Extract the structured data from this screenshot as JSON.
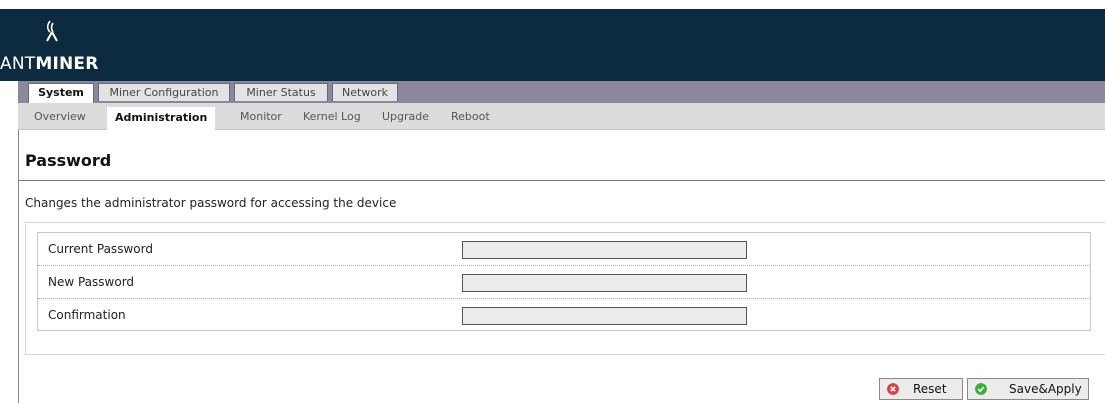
{
  "brand": {
    "logo_prefix": "ANT",
    "logo_suffix": "MINER"
  },
  "main_tabs": [
    {
      "label": "System",
      "active": true
    },
    {
      "label": "Miner Configuration",
      "active": false
    },
    {
      "label": "Miner Status",
      "active": false
    },
    {
      "label": "Network",
      "active": false
    }
  ],
  "sub_tabs": [
    {
      "label": "Overview",
      "active": false
    },
    {
      "label": "Administration",
      "active": true
    },
    {
      "label": "Monitor",
      "active": false
    },
    {
      "label": "Kernel Log",
      "active": false
    },
    {
      "label": "Upgrade",
      "active": false
    },
    {
      "label": "Reboot",
      "active": false
    }
  ],
  "page": {
    "title": "Password",
    "description": "Changes the administrator password for accessing the device"
  },
  "form": {
    "fields": [
      {
        "label": "Current Password",
        "value": ""
      },
      {
        "label": "New Password",
        "value": ""
      },
      {
        "label": "Confirmation",
        "value": ""
      }
    ]
  },
  "actions": {
    "reset_label": "Reset",
    "save_label": "Save&Apply"
  },
  "colors": {
    "header_bg": "#0c2b3e",
    "tabbar_bg": "#8d879e",
    "reset_icon": "#d9414a",
    "save_icon": "#3cae3c"
  },
  "icons": {
    "logo": "antminer-logo-icon",
    "reset": "cancel-circle-icon",
    "save": "check-circle-icon"
  }
}
